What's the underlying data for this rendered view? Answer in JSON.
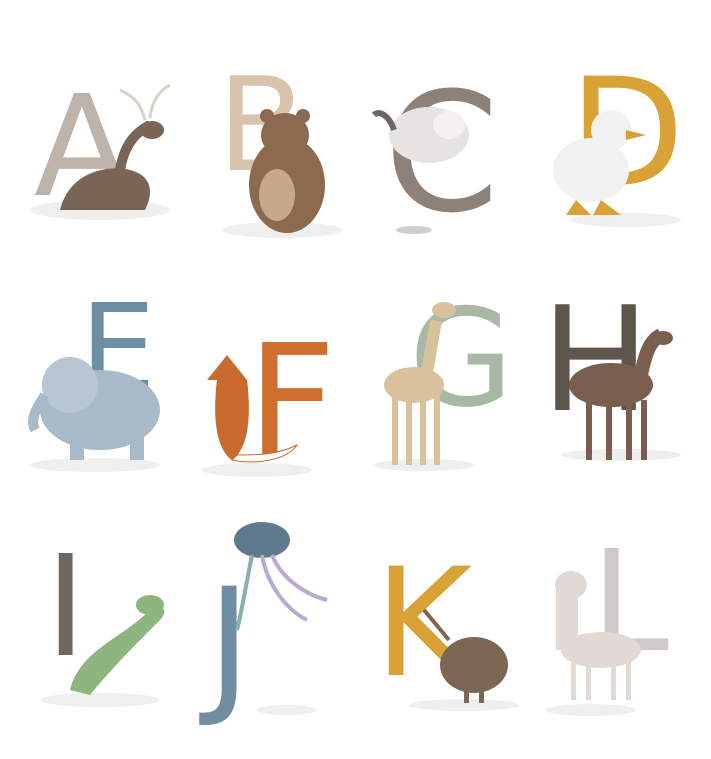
{
  "letters": [
    {
      "char": "A",
      "animal": "deer",
      "color": "#bfb2a8"
    },
    {
      "char": "B",
      "animal": "bear",
      "color": "#d9c3aa"
    },
    {
      "char": "C",
      "animal": "cat",
      "color": "#8e8178"
    },
    {
      "char": "D",
      "animal": "duck",
      "color": "#d9a236"
    },
    {
      "char": "E",
      "animal": "elephant",
      "color": "#6d8ea3"
    },
    {
      "char": "F",
      "animal": "fox",
      "color": "#cc6f2f"
    },
    {
      "char": "G",
      "animal": "giraffe",
      "color": "#a9b8a4"
    },
    {
      "char": "H",
      "animal": "horse",
      "color": "#5d564d"
    },
    {
      "char": "I",
      "animal": "iguana",
      "color": "#6e6660"
    },
    {
      "char": "J",
      "animal": "jellyfish",
      "color": "#6f8ea1"
    },
    {
      "char": "K",
      "animal": "kiwi",
      "color": "#d9a236"
    },
    {
      "char": "L",
      "animal": "llama",
      "color": "#cfcac8"
    }
  ]
}
